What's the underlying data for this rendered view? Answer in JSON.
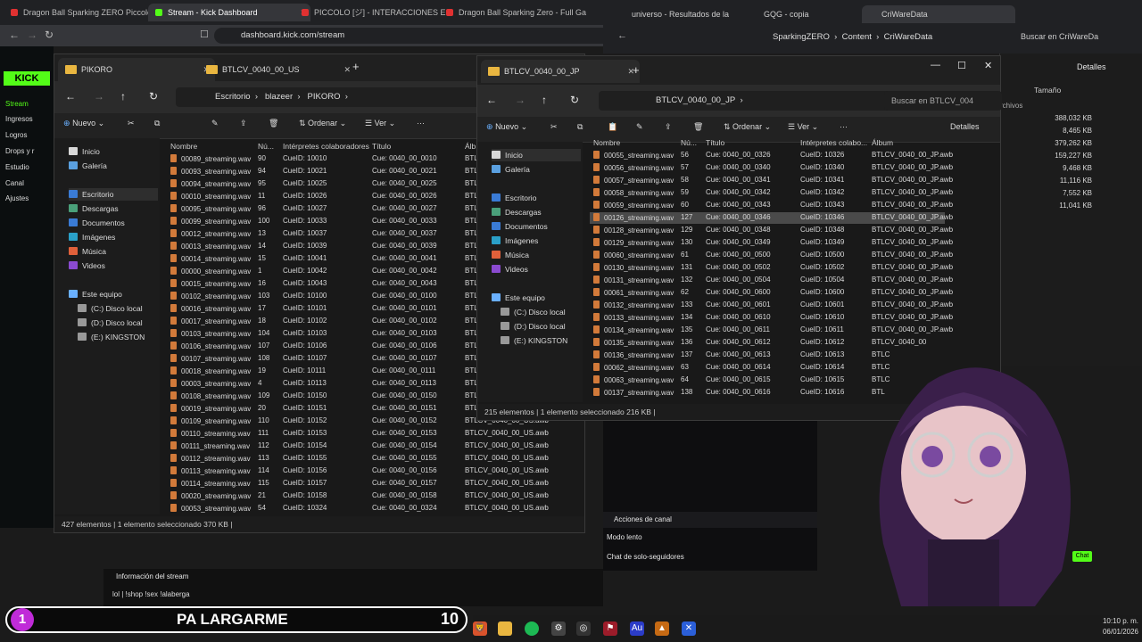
{
  "browser": {
    "tabs": [
      {
        "label": "Dragon Ball Sparking ZERO Piccolo",
        "color": "#e03131"
      },
      {
        "label": "Stream - Kick Dashboard",
        "color": "#53fc18"
      },
      {
        "label": "PICCOLO [ジ] - INTERACCIONES E",
        "color": "#e03131"
      },
      {
        "label": "Dragon Ball Sparking Zero - Full Ga",
        "color": "#e03131"
      }
    ],
    "url": "dashboard.kick.com/stream"
  },
  "kick": {
    "logo": "KICK",
    "items": [
      "Stream",
      "Ingresos",
      "Logros",
      "Drops y r",
      "Estudio",
      "Canal",
      "Ajustes"
    ]
  },
  "explorer1": {
    "tabs": [
      "PIKORO",
      "BTLCV_0040_00_US"
    ],
    "crumbs": [
      "Escritorio",
      "blazeer",
      "PIKORO"
    ],
    "toolbar": {
      "new": "Nuevo",
      "sort": "Ordenar",
      "view": "Ver"
    },
    "sidebar": [
      "Inicio",
      "Galería",
      "Escritorio",
      "Descargas",
      "Documentos",
      "Imágenes",
      "Música",
      "Videos",
      "Este equipo",
      "(C:) Disco local",
      "(D:) Disco local",
      "(E:) KINGSTON"
    ],
    "columns": [
      "Nombre",
      "Nú...",
      "Intérpretes colaboradores",
      "Título",
      "Álb"
    ],
    "rows": [
      [
        "00089_streaming.wav",
        "90",
        "CueID: 10010",
        "Cue: 0040_00_0010",
        "BTLCV"
      ],
      [
        "00093_streaming.wav",
        "94",
        "CueID: 10021",
        "Cue: 0040_00_0021",
        "BTLCV"
      ],
      [
        "00094_streaming.wav",
        "95",
        "CueID: 10025",
        "Cue: 0040_00_0025",
        "BTLCV"
      ],
      [
        "00010_streaming.wav",
        "11",
        "CueID: 10026",
        "Cue: 0040_00_0026",
        "BTLCV"
      ],
      [
        "00095_streaming.wav",
        "96",
        "CueID: 10027",
        "Cue: 0040_00_0027",
        "BTLCV"
      ],
      [
        "00099_streaming.wav",
        "100",
        "CueID: 10033",
        "Cue: 0040_00_0033",
        "BTLCV"
      ],
      [
        "00012_streaming.wav",
        "13",
        "CueID: 10037",
        "Cue: 0040_00_0037",
        "BTLCV"
      ],
      [
        "00013_streaming.wav",
        "14",
        "CueID: 10039",
        "Cue: 0040_00_0039",
        "BTLCV"
      ],
      [
        "00014_streaming.wav",
        "15",
        "CueID: 10041",
        "Cue: 0040_00_0041",
        "BTLCV"
      ],
      [
        "00000_streaming.wav",
        "1",
        "CueID: 10042",
        "Cue: 0040_00_0042",
        "BTLCV"
      ],
      [
        "00015_streaming.wav",
        "16",
        "CueID: 10043",
        "Cue: 0040_00_0043",
        "BTLCV"
      ],
      [
        "00102_streaming.wav",
        "103",
        "CueID: 10100",
        "Cue: 0040_00_0100",
        "BTLCV"
      ],
      [
        "00016_streaming.wav",
        "17",
        "CueID: 10101",
        "Cue: 0040_00_0101",
        "BTLCV"
      ],
      [
        "00017_streaming.wav",
        "18",
        "CueID: 10102",
        "Cue: 0040_00_0102",
        "BTLCV"
      ],
      [
        "00103_streaming.wav",
        "104",
        "CueID: 10103",
        "Cue: 0040_00_0103",
        "BTLCV"
      ],
      [
        "00106_streaming.wav",
        "107",
        "CueID: 10106",
        "Cue: 0040_00_0106",
        "BTLCV"
      ],
      [
        "00107_streaming.wav",
        "108",
        "CueID: 10107",
        "Cue: 0040_00_0107",
        "BTLCV"
      ],
      [
        "00018_streaming.wav",
        "19",
        "CueID: 10111",
        "Cue: 0040_00_0111",
        "BTLCV"
      ],
      [
        "00003_streaming.wav",
        "4",
        "CueID: 10113",
        "Cue: 0040_00_0113",
        "BTLCV"
      ],
      [
        "00108_streaming.wav",
        "109",
        "CueID: 10150",
        "Cue: 0040_00_0150",
        "BTLCV"
      ],
      [
        "00019_streaming.wav",
        "20",
        "CueID: 10151",
        "Cue: 0040_00_0151",
        "BTLCV"
      ],
      [
        "00109_streaming.wav",
        "110",
        "CueID: 10152",
        "Cue: 0040_00_0152",
        "BTLCV_0040_00_US.awb"
      ],
      [
        "00110_streaming.wav",
        "111",
        "CueID: 10153",
        "Cue: 0040_00_0153",
        "BTLCV_0040_00_US.awb"
      ],
      [
        "00111_streaming.wav",
        "112",
        "CueID: 10154",
        "Cue: 0040_00_0154",
        "BTLCV_0040_00_US.awb"
      ],
      [
        "00112_streaming.wav",
        "113",
        "CueID: 10155",
        "Cue: 0040_00_0155",
        "BTLCV_0040_00_US.awb"
      ],
      [
        "00113_streaming.wav",
        "114",
        "CueID: 10156",
        "Cue: 0040_00_0156",
        "BTLCV_0040_00_US.awb"
      ],
      [
        "00114_streaming.wav",
        "115",
        "CueID: 10157",
        "Cue: 0040_00_0157",
        "BTLCV_0040_00_US.awb"
      ],
      [
        "00020_streaming.wav",
        "21",
        "CueID: 10158",
        "Cue: 0040_00_0158",
        "BTLCV_0040_00_US.awb"
      ],
      [
        "00053_streaming.wav",
        "54",
        "CueID: 10324",
        "Cue: 0040_00_0324",
        "BTLCV_0040_00_US.awb"
      ],
      [
        "00054_streaming.wav",
        "55",
        "CueID: 10325",
        "Cue: 0040_00_0325",
        "BTLCV_0040_00_US.awb"
      ]
    ],
    "status": "427 elementos  |  1 elemento seleccionado  370 KB  |"
  },
  "explorer2": {
    "tab": "BTLCV_0040_00_JP",
    "crumb": "BTLCV_0040_00_JP",
    "search": "Buscar en BTLCV_004",
    "toolbar": {
      "new": "Nuevo",
      "sort": "Ordenar",
      "view": "Ver",
      "details": "Detalles"
    },
    "sidebar": [
      "Inicio",
      "Galería",
      "Escritorio",
      "Descargas",
      "Documentos",
      "Imágenes",
      "Música",
      "Videos",
      "Este equipo",
      "(C:) Disco local",
      "(D:) Disco local",
      "(E:) KINGSTON"
    ],
    "columns": [
      "Nombre",
      "Nú...",
      "Título",
      "Intérpretes colabo...",
      "Álbum"
    ],
    "rows": [
      [
        "00055_streaming.wav",
        "56",
        "Cue: 0040_00_0326",
        "CueID: 10326",
        "BTLCV_0040_00_JP.awb"
      ],
      [
        "00056_streaming.wav",
        "57",
        "Cue: 0040_00_0340",
        "CueID: 10340",
        "BTLCV_0040_00_JP.awb"
      ],
      [
        "00057_streaming.wav",
        "58",
        "Cue: 0040_00_0341",
        "CueID: 10341",
        "BTLCV_0040_00_JP.awb"
      ],
      [
        "00058_streaming.wav",
        "59",
        "Cue: 0040_00_0342",
        "CueID: 10342",
        "BTLCV_0040_00_JP.awb"
      ],
      [
        "00059_streaming.wav",
        "60",
        "Cue: 0040_00_0343",
        "CueID: 10343",
        "BTLCV_0040_00_JP.awb"
      ],
      [
        "00126_streaming.wav",
        "127",
        "Cue: 0040_00_0346",
        "CueID: 10346",
        "BTLCV_0040_00_JP.awb"
      ],
      [
        "00128_streaming.wav",
        "129",
        "Cue: 0040_00_0348",
        "CueID: 10348",
        "BTLCV_0040_00_JP.awb"
      ],
      [
        "00129_streaming.wav",
        "130",
        "Cue: 0040_00_0349",
        "CueID: 10349",
        "BTLCV_0040_00_JP.awb"
      ],
      [
        "00060_streaming.wav",
        "61",
        "Cue: 0040_00_0500",
        "CueID: 10500",
        "BTLCV_0040_00_JP.awb"
      ],
      [
        "00130_streaming.wav",
        "131",
        "Cue: 0040_00_0502",
        "CueID: 10502",
        "BTLCV_0040_00_JP.awb"
      ],
      [
        "00131_streaming.wav",
        "132",
        "Cue: 0040_00_0504",
        "CueID: 10504",
        "BTLCV_0040_00_JP.awb"
      ],
      [
        "00061_streaming.wav",
        "62",
        "Cue: 0040_00_0600",
        "CueID: 10600",
        "BTLCV_0040_00_JP.awb"
      ],
      [
        "00132_streaming.wav",
        "133",
        "Cue: 0040_00_0601",
        "CueID: 10601",
        "BTLCV_0040_00_JP.awb"
      ],
      [
        "00133_streaming.wav",
        "134",
        "Cue: 0040_00_0610",
        "CueID: 10610",
        "BTLCV_0040_00_JP.awb"
      ],
      [
        "00134_streaming.wav",
        "135",
        "Cue: 0040_00_0611",
        "CueID: 10611",
        "BTLCV_0040_00_JP.awb"
      ],
      [
        "00135_streaming.wav",
        "136",
        "Cue: 0040_00_0612",
        "CueID: 10612",
        "BTLCV_0040_00"
      ],
      [
        "00136_streaming.wav",
        "137",
        "Cue: 0040_00_0613",
        "CueID: 10613",
        "BTLC"
      ],
      [
        "00062_streaming.wav",
        "63",
        "Cue: 0040_00_0614",
        "CueID: 10614",
        "BTLC"
      ],
      [
        "00063_streaming.wav",
        "64",
        "Cue: 0040_00_0615",
        "CueID: 10615",
        "BTLC"
      ],
      [
        "00137_streaming.wav",
        "138",
        "Cue: 0040_00_0616",
        "CueID: 10616",
        "BTL"
      ]
    ],
    "selected_row": 5,
    "status": "215 elementos  |  1 elemento seleccionado  216 KB  |"
  },
  "browser2": {
    "tabs": [
      "universo - Resultados de la",
      "GQG - copia",
      "CriWareData"
    ],
    "crumbs": [
      "SparkingZERO",
      "Content",
      "CriWareData"
    ],
    "search": "Buscar en CriWareDa",
    "details": "Detalles",
    "col": "Tamaño",
    "archivos": "rchivos",
    "sizes": [
      "388,032 KB",
      "8,465 KB",
      "379,262 KB",
      "159,227 KB",
      "9,468 KB",
      "11,116 KB",
      "7,552 KB",
      "11,041 KB"
    ]
  },
  "stream_panel": {
    "items": [
      "Acciones de canal",
      "Modo lento",
      "Chat de solo-seguidores"
    ],
    "info": "Información del stream",
    "title_line": "lol | !shop !sex !alaberga",
    "conversando": "Conversando",
    "chat_button": "Chat"
  },
  "overlay": {
    "badge": "1",
    "text": "PA LARGARME",
    "count": "10"
  },
  "taskbar": {
    "time": "10:10 p. m.",
    "date": "06/01/2026"
  }
}
